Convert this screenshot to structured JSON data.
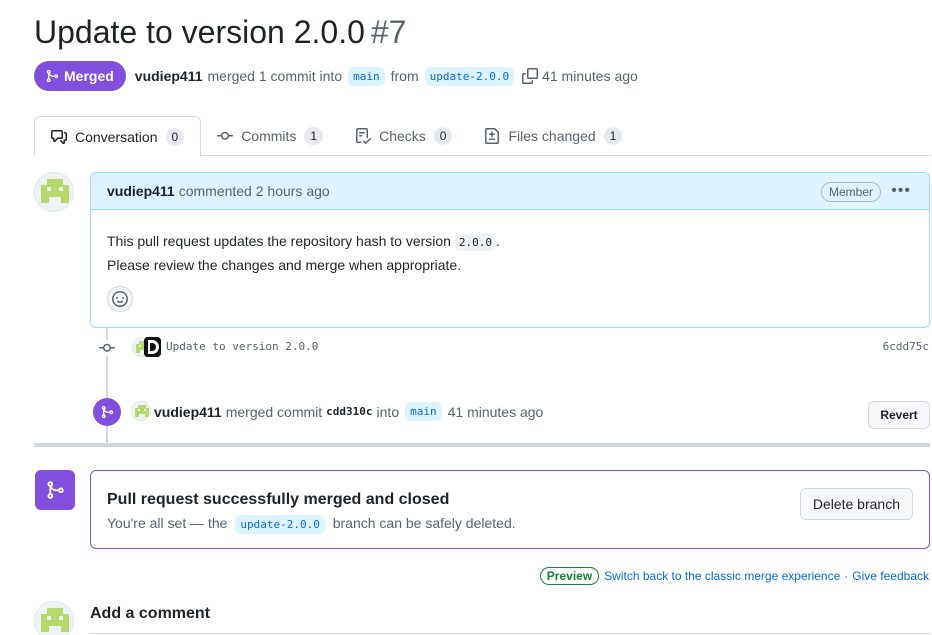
{
  "pr": {
    "title": "Update to version 2.0.0",
    "number": "#7",
    "state": "Merged",
    "author": "vudiep411",
    "summary_merged": "merged 1 commit into",
    "base_branch": "main",
    "from": "from",
    "head_branch": "update-2.0.0",
    "time": "41 minutes ago"
  },
  "tabs": [
    {
      "label": "Conversation",
      "count": "0"
    },
    {
      "label": "Commits",
      "count": "1"
    },
    {
      "label": "Checks",
      "count": "0"
    },
    {
      "label": "Files changed",
      "count": "1"
    }
  ],
  "comment": {
    "author": "vudiep411",
    "action": "commented 2 hours ago",
    "role": "Member",
    "body_line1_pre": "This pull request updates the repository hash to version",
    "body_code": "2.0.0",
    "body_line1_post": ".",
    "body_line2": "Please review the changes and merge when appropriate."
  },
  "commit": {
    "message": "Update to version 2.0.0",
    "sha": "6cdd75c"
  },
  "merge_event": {
    "author": "vudiep411",
    "text": "merged commit",
    "sha": "cdd310c",
    "into": "into",
    "branch": "main",
    "time": "41 minutes ago",
    "revert_label": "Revert"
  },
  "merge_status": {
    "heading": "Pull request successfully merged and closed",
    "sub_pre": "You're all set — the",
    "branch": "update-2.0.0",
    "sub_post": "branch can be safely deleted.",
    "delete_label": "Delete branch"
  },
  "preview": {
    "badge": "Preview",
    "switch_link": "Switch back to the classic merge experience",
    "separator": "·",
    "feedback_link": "Give feedback"
  },
  "add_comment": {
    "title": "Add a comment"
  },
  "colors": {
    "merged_purple": "#8250df",
    "link_blue": "#0969da",
    "comment_header_bg": "#ddf4ff",
    "avatar_green": "#b5d96a"
  },
  "icons": [
    "git-merge-icon",
    "copy-icon",
    "comment-discussion-icon",
    "git-commit-icon",
    "checklist-icon",
    "file-diff-icon",
    "smiley-icon",
    "kebab-horizontal-icon",
    "identicon-avatar"
  ]
}
